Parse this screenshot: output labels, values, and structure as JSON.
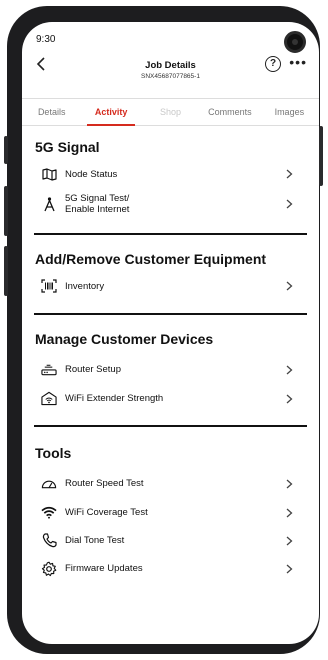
{
  "status": {
    "time": "9:30"
  },
  "header": {
    "title": "Job Details",
    "subtitle": "SNX45687077865-1",
    "back_icon": "chevron-left-icon",
    "help_label": "?",
    "more_label": "•••"
  },
  "tabs": [
    {
      "label": "Details",
      "state": "normal"
    },
    {
      "label": "Activity",
      "state": "active"
    },
    {
      "label": "Shop",
      "state": "disabled"
    },
    {
      "label": "Comments",
      "state": "normal"
    },
    {
      "label": "Images",
      "state": "normal"
    }
  ],
  "sections": {
    "signal": {
      "title": "5G Signal",
      "items": [
        {
          "label": "Node Status",
          "icon": "map-icon"
        },
        {
          "label_line1": "5G Signal Test/",
          "label_line2": "Enable Internet",
          "icon": "antenna-icon"
        }
      ]
    },
    "equipment": {
      "title": "Add/Remove Customer Equipment",
      "items": [
        {
          "label": "Inventory",
          "icon": "barcode-scan-icon"
        }
      ]
    },
    "devices": {
      "title": "Manage Customer Devices",
      "items": [
        {
          "label": "Router Setup",
          "icon": "router-icon"
        },
        {
          "label": "WiFi Extender Strength",
          "icon": "wifi-extender-icon"
        }
      ]
    },
    "tools": {
      "title": "Tools",
      "items": [
        {
          "label": "Router Speed Test",
          "icon": "speedometer-icon"
        },
        {
          "label": "WiFi Coverage Test",
          "icon": "wifi-icon"
        },
        {
          "label": "Dial Tone Test",
          "icon": "phone-icon"
        },
        {
          "label": "Firmware Updates",
          "icon": "gear-icon"
        }
      ]
    }
  },
  "colors": {
    "accent": "#d52b1e",
    "text": "#111111",
    "muted": "#777777",
    "disabled": "#c8c8c8"
  }
}
